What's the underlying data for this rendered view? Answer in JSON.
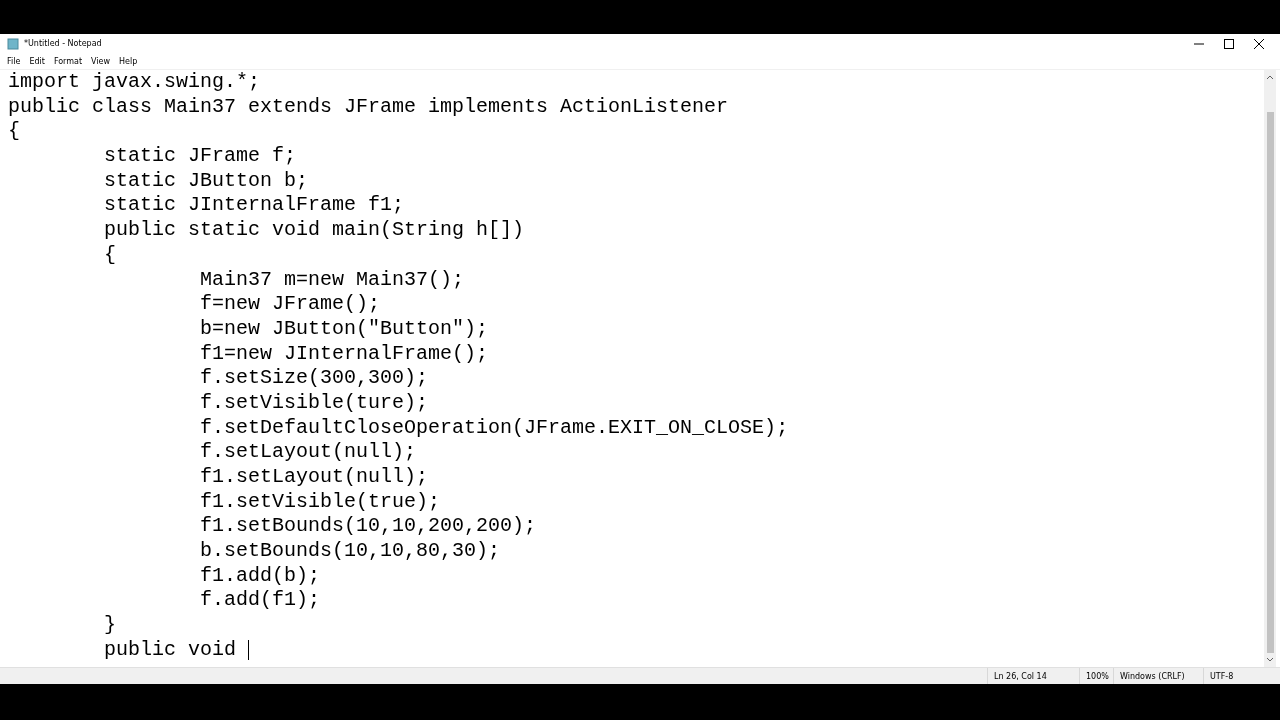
{
  "window": {
    "title": "*Untitled - Notepad"
  },
  "menu": [
    "File",
    "Edit",
    "Format",
    "View",
    "Help"
  ],
  "editor": {
    "lines": [
      "import javax.swing.*;",
      "public class Main37 extends JFrame implements ActionListener",
      "{",
      "\tstatic JFrame f;",
      "\tstatic JButton b;",
      "\tstatic JInternalFrame f1;",
      "\tpublic static void main(String h[])",
      "\t{",
      "\t\tMain37 m=new Main37();",
      "\t\tf=new JFrame();",
      "\t\tb=new JButton(\"Button\");",
      "\t\tf1=new JInternalFrame();",
      "\t\tf.setSize(300,300);",
      "\t\tf.setVisible(ture);",
      "\t\tf.setDefaultCloseOperation(JFrame.EXIT_ON_CLOSE);",
      "\t\tf.setLayout(null);",
      "\t\tf1.setLayout(null);",
      "\t\tf1.setVisible(true);",
      "\t\tf1.setBounds(10,10,200,200);",
      "\t\tb.setBounds(10,10,80,30);",
      "\t\tf1.add(b);",
      "\t\tf.add(f1);",
      "\t}",
      "\tpublic void "
    ]
  },
  "status_bar": {
    "position": "Ln 26, Col 14",
    "zoom": "100%",
    "line_ending": "Windows (CRLF)",
    "encoding": "UTF-8"
  }
}
